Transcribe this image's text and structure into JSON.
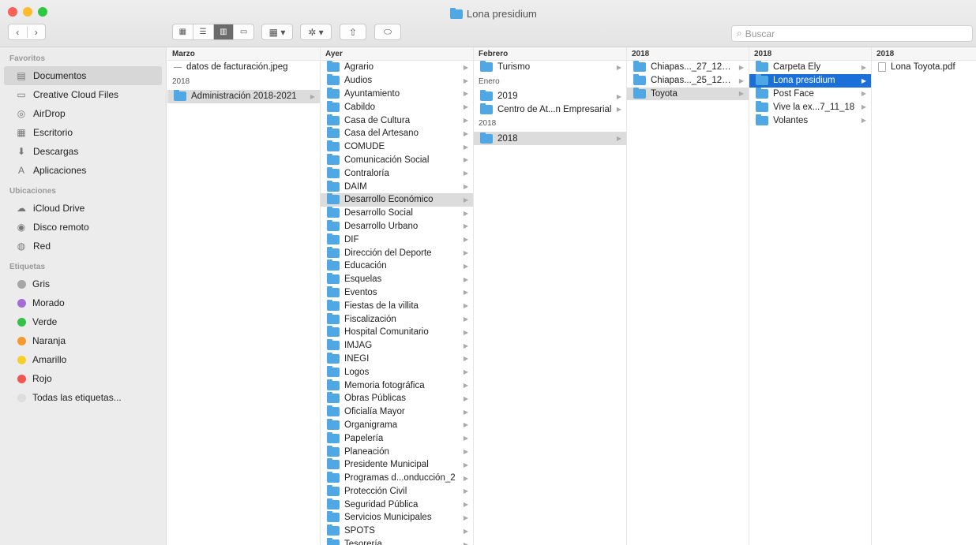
{
  "window": {
    "title": "Lona presidium"
  },
  "toolbar": {
    "back": "‹",
    "forward": "›",
    "views": [
      "▦",
      "☰",
      "▥",
      "▭"
    ],
    "group": "▦ ▾",
    "action": "✲ ▾",
    "share": "⇧",
    "tag": "⬭",
    "search_placeholder": "Buscar"
  },
  "sidebar": {
    "favorites_title": "Favoritos",
    "favorites": [
      {
        "label": "Documentos",
        "icon": "documents-icon",
        "glyph": "▤"
      },
      {
        "label": "Creative Cloud Files",
        "icon": "folder-icon",
        "glyph": "▭"
      },
      {
        "label": "AirDrop",
        "icon": "airdrop-icon",
        "glyph": "◎"
      },
      {
        "label": "Escritorio",
        "icon": "desktop-icon",
        "glyph": "▦"
      },
      {
        "label": "Descargas",
        "icon": "downloads-icon",
        "glyph": "⬇"
      },
      {
        "label": "Aplicaciones",
        "icon": "applications-icon",
        "glyph": "A"
      }
    ],
    "locations_title": "Ubicaciones",
    "locations": [
      {
        "label": "iCloud Drive",
        "icon": "cloud-icon",
        "glyph": "☁"
      },
      {
        "label": "Disco remoto",
        "icon": "disc-icon",
        "glyph": "◉"
      },
      {
        "label": "Red",
        "icon": "network-icon",
        "glyph": "◍"
      }
    ],
    "tags_title": "Etiquetas",
    "tags": [
      {
        "label": "Gris",
        "color": "#a5a5a5"
      },
      {
        "label": "Morado",
        "color": "#a56bd6"
      },
      {
        "label": "Verde",
        "color": "#34c244"
      },
      {
        "label": "Naranja",
        "color": "#f59b2e"
      },
      {
        "label": "Amarillo",
        "color": "#f7cf2b"
      },
      {
        "label": "Rojo",
        "color": "#f25450"
      },
      {
        "label": "Todas las etiquetas...",
        "color": "#dddddd"
      }
    ]
  },
  "columns": {
    "col1": {
      "groups": [
        {
          "title": "Marzo",
          "items": [
            {
              "label": "datos de facturación.jpeg",
              "type": "file"
            }
          ]
        },
        {
          "title": "2018",
          "items": [
            {
              "label": "Administración 2018-2021",
              "type": "folder",
              "state": "hl"
            }
          ]
        }
      ]
    },
    "col2": {
      "groups": [
        {
          "title": "Ayer",
          "items": [
            {
              "label": "Agrario"
            },
            {
              "label": "Audios"
            },
            {
              "label": "Ayuntamiento"
            },
            {
              "label": "Cabildo"
            },
            {
              "label": "Casa de Cultura"
            },
            {
              "label": "Casa del Artesano"
            },
            {
              "label": "COMUDE"
            },
            {
              "label": "Comunicación Social"
            },
            {
              "label": "Contraloría"
            },
            {
              "label": "DAIM"
            },
            {
              "label": "Desarrollo Económico",
              "state": "hl"
            },
            {
              "label": "Desarrollo Social"
            },
            {
              "label": "Desarrollo Urbano"
            },
            {
              "label": "DIF"
            },
            {
              "label": "Dirección del Deporte"
            },
            {
              "label": "Educación"
            },
            {
              "label": "Esquelas"
            },
            {
              "label": "Eventos"
            },
            {
              "label": "Fiestas de la villita"
            },
            {
              "label": "Fiscalización"
            },
            {
              "label": "Hospital Comunitario"
            },
            {
              "label": "IMJAG"
            },
            {
              "label": "INEGI"
            },
            {
              "label": "Logos"
            },
            {
              "label": "Memoria fotográfica"
            },
            {
              "label": "Obras Públicas"
            },
            {
              "label": "Oficialía Mayor"
            },
            {
              "label": "Organigrama"
            },
            {
              "label": "Papelería"
            },
            {
              "label": "Planeación"
            },
            {
              "label": "Presidente Municipal"
            },
            {
              "label": "Programas d...onducción_2"
            },
            {
              "label": "Protección Civil"
            },
            {
              "label": "Seguridad Pública"
            },
            {
              "label": "Servicios Municipales"
            },
            {
              "label": "SPOTS"
            },
            {
              "label": "Tesorería"
            }
          ]
        }
      ]
    },
    "col3": {
      "groups": [
        {
          "title": "Febrero",
          "items": [
            {
              "label": "Turismo"
            }
          ]
        },
        {
          "title": "Enero",
          "items": [
            {
              "label": "2019"
            },
            {
              "label": "Centro de At...n Empresarial"
            }
          ]
        },
        {
          "title": "2018",
          "items": [
            {
              "label": "2018",
              "state": "hl"
            }
          ]
        }
      ]
    },
    "col4": {
      "groups": [
        {
          "title": "2018",
          "items": [
            {
              "label": "Chiapas..._27_12_18"
            },
            {
              "label": "Chiapas..._25_12_18"
            },
            {
              "label": "Toyota",
              "state": "hl"
            }
          ]
        }
      ]
    },
    "col5": {
      "groups": [
        {
          "title": "2018",
          "items": [
            {
              "label": "Carpeta Ely"
            },
            {
              "label": "Lona presidium",
              "state": "sel"
            },
            {
              "label": "Post Face"
            },
            {
              "label": "Vive la ex...7_11_18"
            },
            {
              "label": "Volantes"
            }
          ]
        }
      ]
    },
    "col6": {
      "groups": [
        {
          "title": "2018",
          "items": [
            {
              "label": "Lona Toyota.pdf",
              "type": "file"
            }
          ]
        }
      ]
    }
  }
}
